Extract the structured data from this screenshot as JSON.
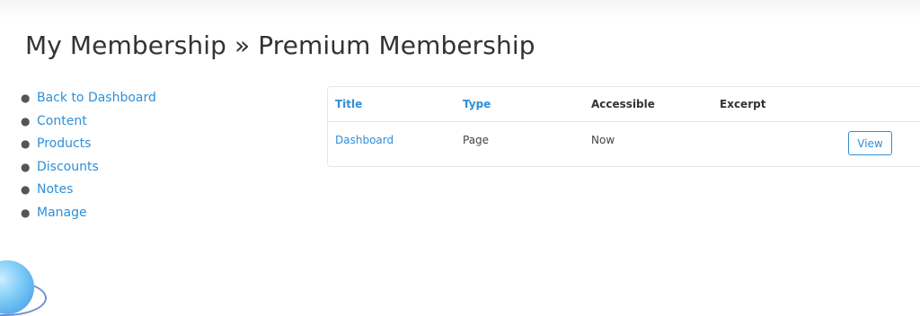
{
  "page": {
    "title": "My Membership » Premium Membership"
  },
  "nav": {
    "items": [
      {
        "label": "Back to Dashboard"
      },
      {
        "label": "Content"
      },
      {
        "label": "Products"
      },
      {
        "label": "Discounts"
      },
      {
        "label": "Notes"
      },
      {
        "label": "Manage"
      }
    ]
  },
  "table": {
    "columns": [
      "Title",
      "Type",
      "Accessible",
      "Excerpt"
    ],
    "rows": [
      {
        "title": "Dashboard",
        "type": "Page",
        "accessible": "Now",
        "excerpt": "",
        "action_label": "View"
      }
    ]
  },
  "colors": {
    "link": "#2f8fd8",
    "text": "#333333",
    "border": "#e6e6e6"
  },
  "icons": {
    "bullet": "bullet-dot-icon",
    "floating_widget": "floating-sphere-icon"
  }
}
